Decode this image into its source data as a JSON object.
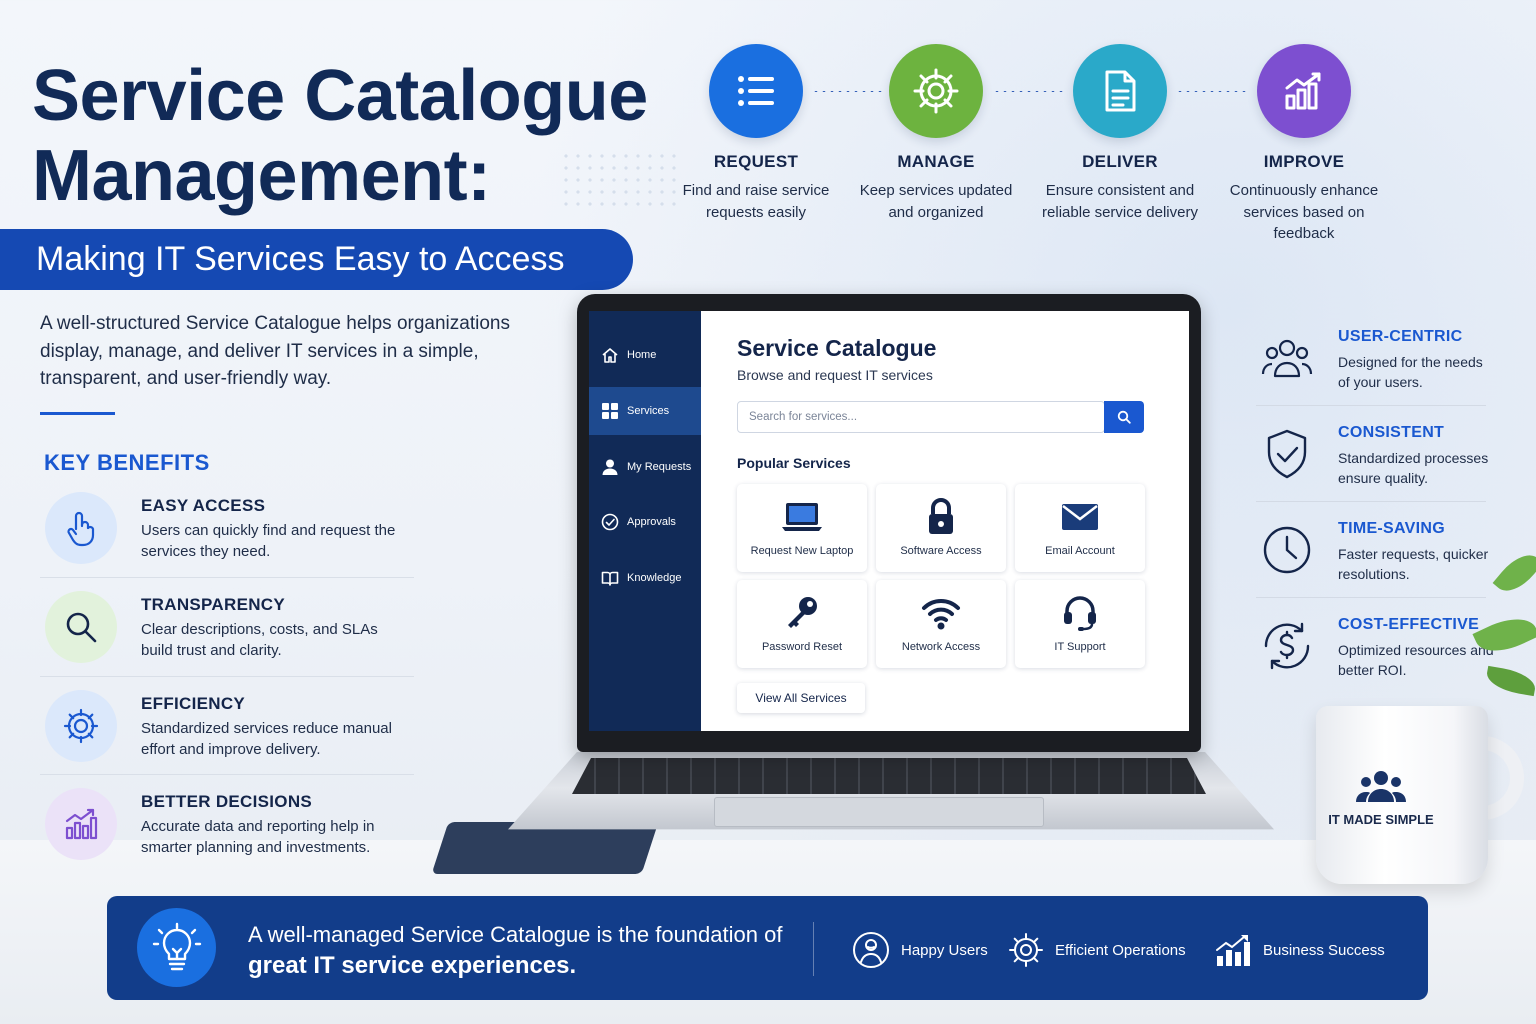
{
  "header": {
    "title_line1": "Service Catalogue",
    "title_line2": "Management:",
    "subtitle": "Making IT Services Easy to Access",
    "intro": "A well-structured Service Catalogue helps organizations display, manage, and deliver IT services in a simple, transparent, and user-friendly way."
  },
  "key_benefits": {
    "heading": "KEY BENEFITS",
    "items": [
      {
        "title": "EASY ACCESS",
        "desc": "Users can quickly find and request the services they need.",
        "icon": "hand-pointer-icon"
      },
      {
        "title": "TRANSPARENCY",
        "desc": "Clear descriptions, costs, and SLAs build trust and clarity.",
        "icon": "magnifier-icon"
      },
      {
        "title": "EFFICIENCY",
        "desc": "Standardized services reduce manual effort and improve delivery.",
        "icon": "gear-icon"
      },
      {
        "title": "BETTER DECISIONS",
        "desc": "Accurate data and reporting help in smarter planning and investments.",
        "icon": "bar-chart-icon"
      }
    ]
  },
  "steps": [
    {
      "title": "REQUEST",
      "desc": "Find and raise service requests easily",
      "color": "#1a6fe0",
      "icon": "list-icon"
    },
    {
      "title": "MANAGE",
      "desc": "Keep services updated and organized",
      "color": "#6db33f",
      "icon": "gear-icon"
    },
    {
      "title": "DELIVER",
      "desc": "Ensure consistent and reliable service delivery",
      "color": "#2aa9c9",
      "icon": "document-icon"
    },
    {
      "title": "IMPROVE",
      "desc": "Continuously enhance services based on feedback",
      "color": "#7d4fd0",
      "icon": "growth-chart-icon"
    }
  ],
  "app": {
    "nav": [
      {
        "label": "Home",
        "icon": "home-icon"
      },
      {
        "label": "Services",
        "icon": "grid-icon",
        "active": true
      },
      {
        "label": "My Requests",
        "icon": "user-icon"
      },
      {
        "label": "Approvals",
        "icon": "check-circle-icon"
      },
      {
        "label": "Knowledge",
        "icon": "book-icon"
      }
    ],
    "title": "Service Catalogue",
    "subtitle": "Browse and request IT services",
    "search_placeholder": "Search for services...",
    "popular_heading": "Popular Services",
    "tiles": [
      {
        "label": "Request New Laptop",
        "icon": "laptop-icon"
      },
      {
        "label": "Software Access",
        "icon": "lock-icon"
      },
      {
        "label": "Email Account",
        "icon": "envelope-icon"
      },
      {
        "label": "Password Reset",
        "icon": "key-icon"
      },
      {
        "label": "Network Access",
        "icon": "wifi-icon"
      },
      {
        "label": "IT Support",
        "icon": "headset-icon"
      }
    ],
    "view_all": "View All Services"
  },
  "features": [
    {
      "title": "USER-CENTRIC",
      "desc": "Designed for the needs of your users.",
      "icon": "users-icon"
    },
    {
      "title": "CONSISTENT",
      "desc": "Standardized processes ensure quality.",
      "icon": "shield-check-icon"
    },
    {
      "title": "TIME-SAVING",
      "desc": "Faster requests, quicker resolutions.",
      "icon": "clock-icon"
    },
    {
      "title": "COST-EFFECTIVE",
      "desc": "Optimized resources and better ROI.",
      "icon": "dollar-cycle-icon"
    }
  ],
  "mug": {
    "text": "IT MADE SIMPLE"
  },
  "footer": {
    "line1": "A well-managed Service Catalogue is the foundation of",
    "line2": "great IT service experiences.",
    "items": [
      {
        "label": "Happy Users",
        "icon": "happy-user-icon"
      },
      {
        "label": "Efficient Operations",
        "icon": "gear-icon"
      },
      {
        "label": "Business Success",
        "icon": "growth-chart-icon"
      }
    ]
  },
  "colors": {
    "navy": "#112a57",
    "primary_blue": "#1a58d0",
    "banner_blue": "#1549b3",
    "footer_blue": "#123d8a"
  }
}
